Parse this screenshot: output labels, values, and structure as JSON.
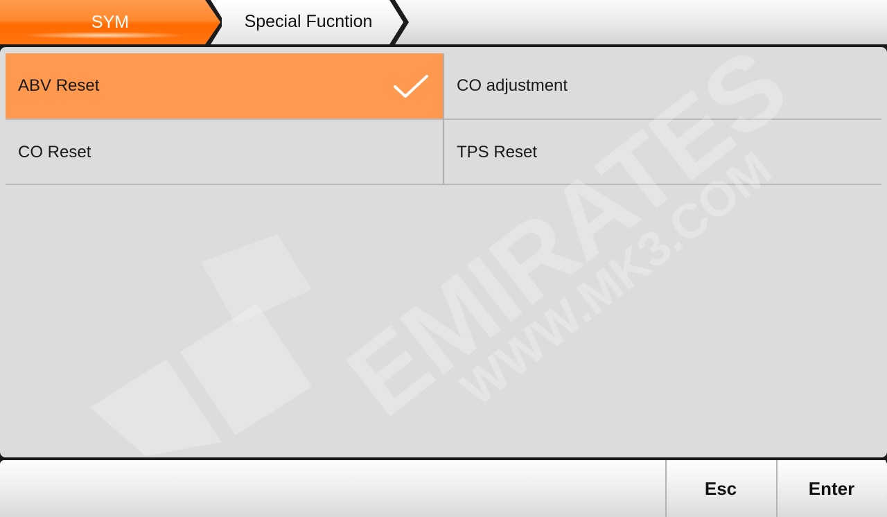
{
  "breadcrumb": {
    "items": [
      {
        "label": "SYM",
        "active": true
      },
      {
        "label": "Special Fucntion",
        "active": false
      }
    ]
  },
  "menu": {
    "items": [
      {
        "label": "ABV Reset",
        "selected": true
      },
      {
        "label": "CO adjustment",
        "selected": false
      },
      {
        "label": "CO Reset",
        "selected": false
      },
      {
        "label": "TPS Reset",
        "selected": false
      }
    ],
    "selected_icon": "checkmark-icon"
  },
  "watermark": {
    "brand": "EMIRATES",
    "url": "WWW.MK3.COM"
  },
  "bottom_bar": {
    "esc_label": "Esc",
    "enter_label": "Enter"
  },
  "colors": {
    "accent": "#ff7a1a",
    "selected_row": "#ff9950",
    "panel_bg": "#dcdcdc"
  }
}
